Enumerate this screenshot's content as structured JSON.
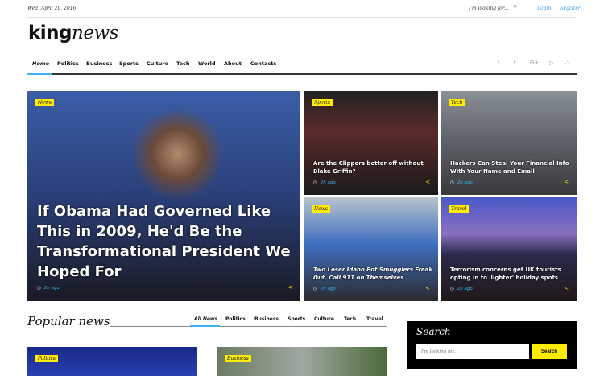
{
  "topbar": {
    "date": "Wed. April 20, 2016",
    "search_placeholder": "I'm looking for...",
    "login": "Login",
    "register": "Register"
  },
  "logo": {
    "bold": "king",
    "italic": "news"
  },
  "nav": {
    "items": [
      "Home",
      "Politics",
      "Business",
      "Sports",
      "Culture",
      "Tech",
      "World",
      "About",
      "Contacts"
    ],
    "social": [
      "facebook-icon",
      "twitter-icon",
      "google-plus-icon",
      "youtube-icon",
      "rss-icon"
    ]
  },
  "hero": {
    "tag": "News",
    "title": "If Obama Had Governed Like This in 2009, He'd Be the Transformational President We Hoped For",
    "time": "2h ago"
  },
  "tiles": [
    {
      "tag": "Sports",
      "title": "Are the Clippers better off without Blake Griffin?",
      "time": "2h ago"
    },
    {
      "tag": "Tech",
      "title": "Hackers Can Steal Your Financial Info With Your Name and Email",
      "time": "2h ago"
    },
    {
      "tag": "News",
      "title": "Two Loser Idaho Pot Smugglers Freak Out, Call 911 on Themselves",
      "time": "2h ago"
    },
    {
      "tag": "Travel",
      "title": "Terrorism concerns get UK tourists opting in to 'lighter' holiday spots",
      "time": "2h ago"
    }
  ],
  "popular": {
    "title": "Popular news",
    "tabs": [
      "All News",
      "Politics",
      "Business",
      "Sports",
      "Culture",
      "Tech",
      "Travel"
    ],
    "cards": [
      {
        "tag": "Politics"
      },
      {
        "tag": "Business"
      }
    ]
  },
  "search_widget": {
    "title": "Search",
    "placeholder": "I'm looking for...",
    "button": "Search"
  },
  "colors": {
    "accent": "#3ab4f2",
    "tag": "#ffec00"
  }
}
